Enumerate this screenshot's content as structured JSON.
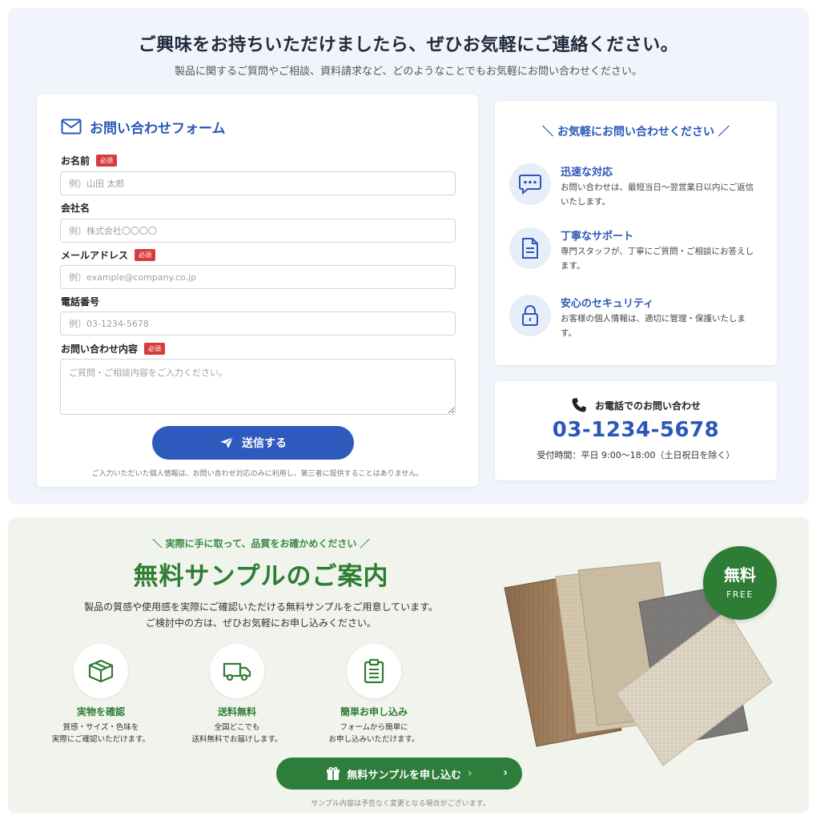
{
  "contact": {
    "headline": "ご興味をお持ちいただけましたら、ぜひお気軽にご連絡ください。",
    "subline": "製品に関するご質問やご相談、資料請求など、どのようなことでもお気軽にお問い合わせください。",
    "form": {
      "title": "お問い合わせフォーム",
      "required_badge": "必須",
      "fields": {
        "name": {
          "label": "お名前",
          "placeholder": "例）山田 太郎"
        },
        "company": {
          "label": "会社名",
          "placeholder": "例）株式会社〇〇〇〇"
        },
        "email": {
          "label": "メールアドレス",
          "placeholder": "例）example@company.co.jp"
        },
        "phone": {
          "label": "電話番号",
          "placeholder": "例）03-1234-5678"
        },
        "message": {
          "label": "お問い合わせ内容",
          "placeholder": "ご質問・ご相談内容をご入力ください。"
        }
      },
      "submit_label": "送信する",
      "privacy_note": "ご入力いただいた個人情報は、お問い合わせ対応のみに利用し、第三者に提供することはありません。"
    },
    "info": {
      "heading": "＼ お気軽にお問い合わせください ／",
      "features": [
        {
          "icon": "chat-bubble-icon",
          "title": "迅速な対応",
          "desc": "お問い合わせは、最短当日〜翌営業日以内にご返信いたします。"
        },
        {
          "icon": "document-icon",
          "title": "丁寧なサポート",
          "desc": "専門スタッフが、丁寧にご質問・ご相談にお答えします。"
        },
        {
          "icon": "lock-icon",
          "title": "安心のセキュリティ",
          "desc": "お客様の個人情報は、適切に管理・保護いたします。"
        }
      ]
    },
    "phone": {
      "label": "お電話でのお問い合わせ",
      "number": "03-1234-5678",
      "hours": "受付時間：平日 9:00〜18:00（土日祝日を除く）"
    }
  },
  "sample": {
    "tagline": "＼ 実際に手に取って、品質をお確かめください ／",
    "title": "無料サンプルのご案内",
    "desc_line1": "製品の質感や使用感を実際にご確認いただける無料サンプルをご用意しています。",
    "desc_line2": "ご検討中の方は、ぜひお気軽にお申し込みください。",
    "benefits": [
      {
        "icon": "box-icon",
        "title": "実物を確認",
        "desc_line1": "質感・サイズ・色味を",
        "desc_line2": "実際にご確認いただけます。"
      },
      {
        "icon": "truck-icon",
        "title": "送料無料",
        "desc_line1": "全国どこでも",
        "desc_line2": "送料無料でお届けします。"
      },
      {
        "icon": "clipboard-icon",
        "title": "簡単お申し込み",
        "desc_line1": "フォームから簡単に",
        "desc_line2": "お申し込みいただけます。"
      }
    ],
    "apply_label": "無料サンプルを申し込む",
    "badge_main": "無料",
    "badge_sub": "FREE",
    "note": "サンプル内容は予告なく変更となる場合がございます。"
  },
  "colors": {
    "brand_blue": "#2b57b8",
    "brand_green": "#2e7d34",
    "required_red": "#d63c3c"
  }
}
